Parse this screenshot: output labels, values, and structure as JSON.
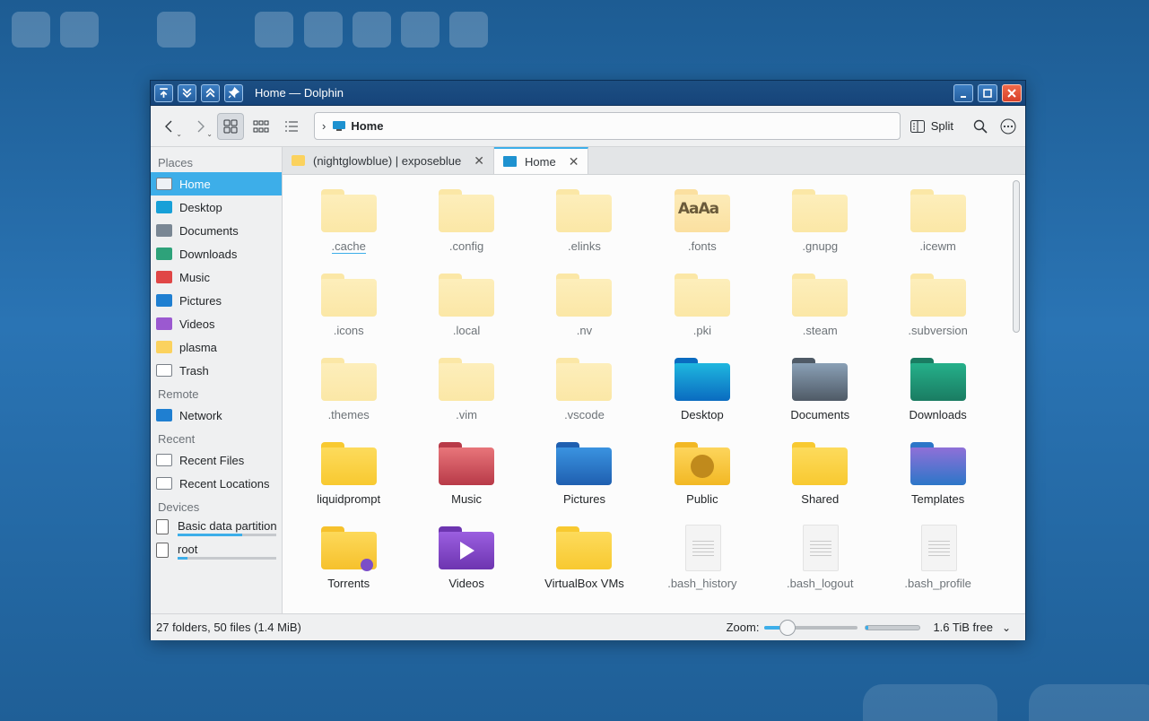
{
  "window": {
    "title": "Home — Dolphin"
  },
  "toolbar": {
    "location": "Home",
    "split_label": "Split"
  },
  "tabs": [
    {
      "label": "(nightglowblue) | exposeblue",
      "active": false,
      "icon": "folder-icon"
    },
    {
      "label": "Home",
      "active": true,
      "icon": "monitor-icon"
    }
  ],
  "sidebar": {
    "sections": {
      "places": "Places",
      "remote": "Remote",
      "recent": "Recent",
      "devices": "Devices"
    },
    "places": [
      {
        "label": "Home",
        "color": "#eef2f6"
      },
      {
        "label": "Desktop",
        "color": "#17a0d8"
      },
      {
        "label": "Documents",
        "color": "#7a8794"
      },
      {
        "label": "Downloads",
        "color": "#2ea27a"
      },
      {
        "label": "Music",
        "color": "#e04646"
      },
      {
        "label": "Pictures",
        "color": "#1f7fd1"
      },
      {
        "label": "Videos",
        "color": "#9b59d0"
      },
      {
        "label": "plasma",
        "color": "#fbd25e"
      },
      {
        "label": "Trash",
        "color": "#ffffff"
      }
    ],
    "remote": [
      {
        "label": "Network",
        "color": "#1f7fd1"
      }
    ],
    "recent": [
      {
        "label": "Recent Files",
        "color": "#ffffff"
      },
      {
        "label": "Recent Locations",
        "color": "#ffffff"
      }
    ],
    "devices": [
      {
        "label": "Basic data partition",
        "usage": 0.65
      },
      {
        "label": "root",
        "usage": 0.1
      }
    ]
  },
  "files": [
    {
      "name": ".cache",
      "kind": "folder-light"
    },
    {
      "name": ".config",
      "kind": "folder-light"
    },
    {
      "name": ".elinks",
      "kind": "folder-light"
    },
    {
      "name": ".fonts",
      "kind": "folder-fonts",
      "glyph": "AaAa"
    },
    {
      "name": ".gnupg",
      "kind": "folder-light"
    },
    {
      "name": ".icewm",
      "kind": "folder-light"
    },
    {
      "name": ".icons",
      "kind": "folder-light"
    },
    {
      "name": ".local",
      "kind": "folder-light"
    },
    {
      "name": ".nv",
      "kind": "folder-light"
    },
    {
      "name": ".pki",
      "kind": "folder-light"
    },
    {
      "name": ".steam",
      "kind": "folder-light"
    },
    {
      "name": ".subversion",
      "kind": "folder-light"
    },
    {
      "name": ".themes",
      "kind": "folder-light"
    },
    {
      "name": ".vim",
      "kind": "folder-light"
    },
    {
      "name": ".vscode",
      "kind": "folder-light"
    },
    {
      "name": "Desktop",
      "kind": "folder-desktop"
    },
    {
      "name": "Documents",
      "kind": "folder-documents"
    },
    {
      "name": "Downloads",
      "kind": "folder-downloads"
    },
    {
      "name": "liquidprompt",
      "kind": "folder"
    },
    {
      "name": "Music",
      "kind": "folder-music"
    },
    {
      "name": "Pictures",
      "kind": "folder-pictures"
    },
    {
      "name": "Public",
      "kind": "folder-public"
    },
    {
      "name": "Shared",
      "kind": "folder"
    },
    {
      "name": "Templates",
      "kind": "folder-templates"
    },
    {
      "name": "Torrents",
      "kind": "folder-torrents"
    },
    {
      "name": "Videos",
      "kind": "folder-videos"
    },
    {
      "name": "VirtualBox VMs",
      "kind": "folder"
    },
    {
      "name": ".bash_history",
      "kind": "text-file"
    },
    {
      "name": ".bash_logout",
      "kind": "text-file"
    },
    {
      "name": ".bash_profile",
      "kind": "text-file"
    }
  ],
  "status": {
    "summary": "27 folders, 50 files (1.4 MiB)",
    "zoom_label": "Zoom:",
    "zoom_level": 0.25,
    "free_space": "1.6 TiB free",
    "used_fraction": 0.05
  }
}
